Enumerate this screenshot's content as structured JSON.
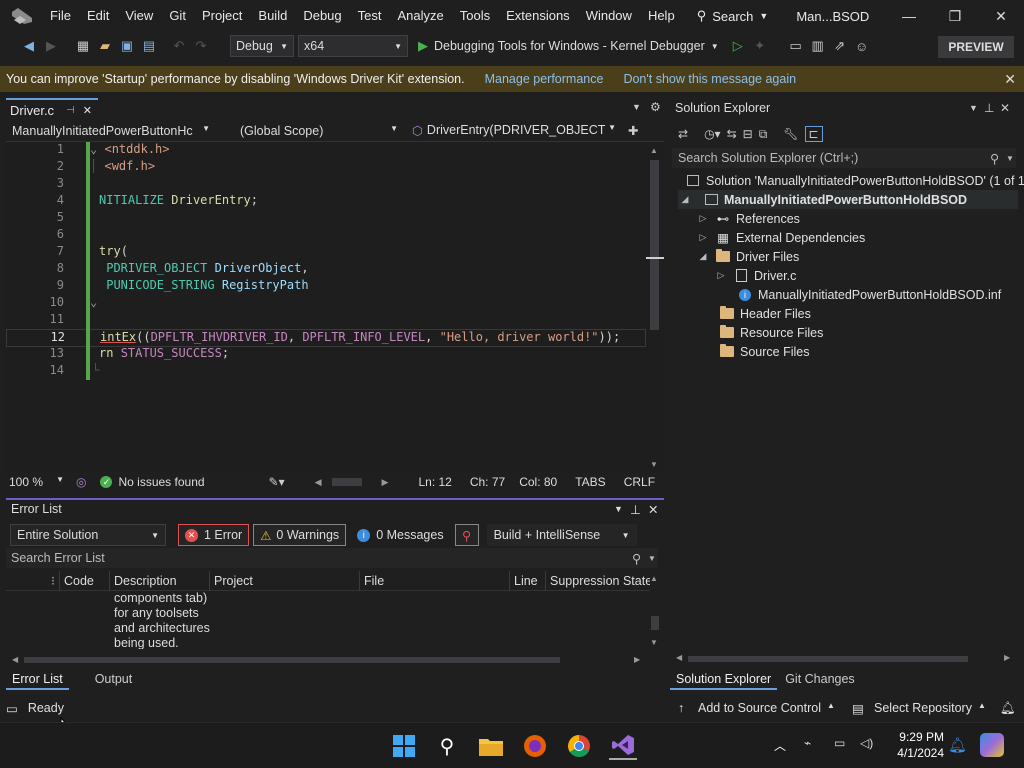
{
  "menubar": {
    "items": [
      "File",
      "Edit",
      "View",
      "Git",
      "Project",
      "Build",
      "Debug",
      "Test",
      "Analyze",
      "Tools",
      "Extensions",
      "Window",
      "Help"
    ],
    "search_label": "Search",
    "window_title": "Man...BSOD"
  },
  "toolbar": {
    "config": "Debug",
    "platform": "x64",
    "run_target": "Debugging Tools for Windows - Kernel Debugger",
    "preview_label": "PREVIEW"
  },
  "infobar": {
    "message": "You can improve 'Startup' performance by disabling 'Windows Driver Kit' extension.",
    "link_manage": "Manage performance",
    "link_dismiss": "Don't show this message again"
  },
  "editor": {
    "tab_label": "Driver.c",
    "nav_project": "ManuallyInitiatedPowerButtonHc",
    "nav_scope": "(Global Scope)",
    "nav_function": "DriverEntry(PDRIVER_OBJECT Driv",
    "line_numbers": [
      "1",
      "2",
      "3",
      "4",
      "5",
      "6",
      "7",
      "8",
      "9",
      "10",
      "11",
      "12",
      "13",
      "14"
    ],
    "current_line": "12",
    "zoom": "100 %",
    "issues": "No issues found",
    "ln": "Ln: 12",
    "ch": "Ch: 77",
    "col": "Col: 80",
    "tabs": "TABS",
    "eol": "CRLF"
  },
  "errorlist": {
    "title": "Error List",
    "scope": "Entire Solution",
    "errors": "1 Error",
    "warnings": "0 Warnings",
    "messages": "0 Messages",
    "source": "Build + IntelliSense",
    "search_placeholder": "Search Error List",
    "columns": [
      "Code",
      "Description",
      "Project",
      "File",
      "Line",
      "Suppression State"
    ],
    "description_fragment": "components tab) for any toolsets and architectures being used. Learn"
  },
  "bottom_tabs": [
    "Error List",
    "Output"
  ],
  "solution_explorer": {
    "title": "Solution Explorer",
    "search_placeholder": "Search Solution Explorer (Ctrl+;)",
    "solution": "Solution 'ManuallyInitiatedPowerButtonHoldBSOD' (1 of 1",
    "project": "ManuallyInitiatedPowerButtonHoldBSOD",
    "references": "References",
    "external": "External Dependencies",
    "driver_files": "Driver Files",
    "driver_c": "Driver.c",
    "inf": "ManuallyInitiatedPowerButtonHoldBSOD.inf",
    "header_files": "Header Files",
    "resource_files": "Resource Files",
    "source_files": "Source Files",
    "tabs": [
      "Solution Explorer",
      "Git Changes"
    ]
  },
  "statusbar": {
    "ready": "Ready",
    "source_control": "Add to Source Control",
    "repository": "Select Repository"
  },
  "taskbar": {
    "time": "9:29 PM",
    "date": "4/1/2024"
  },
  "colors": {
    "accent": "#6b9fd8",
    "infobar_bg": "#4b3e1b",
    "error_red": "#e05252",
    "warning_yellow": "#e8c32c"
  }
}
